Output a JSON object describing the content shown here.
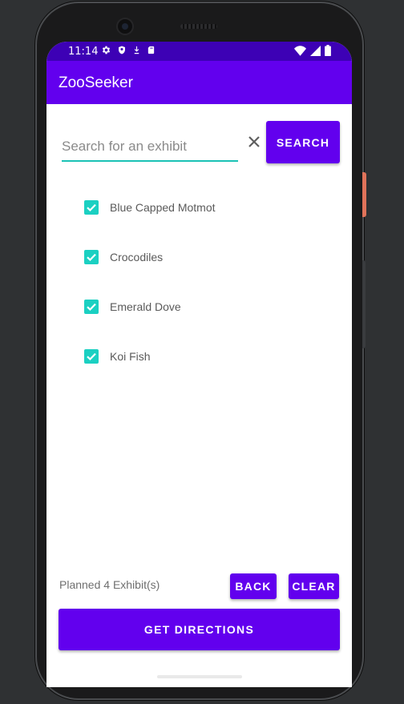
{
  "status_bar": {
    "time": "11:14",
    "left_icons": [
      "gear-icon",
      "shield-icon",
      "download-icon",
      "sd-card-icon"
    ],
    "right_icons": [
      "wifi-icon",
      "signal-icon",
      "battery-icon"
    ]
  },
  "app_bar": {
    "title": "ZooSeeker"
  },
  "search": {
    "placeholder": "Search for an exhibit",
    "value": "",
    "button_label": "SEARCH"
  },
  "exhibits": [
    {
      "label": "Blue Capped Motmot",
      "checked": true
    },
    {
      "label": "Crocodiles",
      "checked": true
    },
    {
      "label": "Emerald Dove",
      "checked": true
    },
    {
      "label": "Koi Fish",
      "checked": true
    }
  ],
  "footer": {
    "planned_text": "Planned 4 Exhibit(s)",
    "back_label": "BACK",
    "clear_label": "CLEAR",
    "directions_label": "GET DIRECTIONS"
  },
  "colors": {
    "primary": "#6200ee",
    "status_bar": "#3d01b5",
    "accent": "#1bd0c2"
  }
}
